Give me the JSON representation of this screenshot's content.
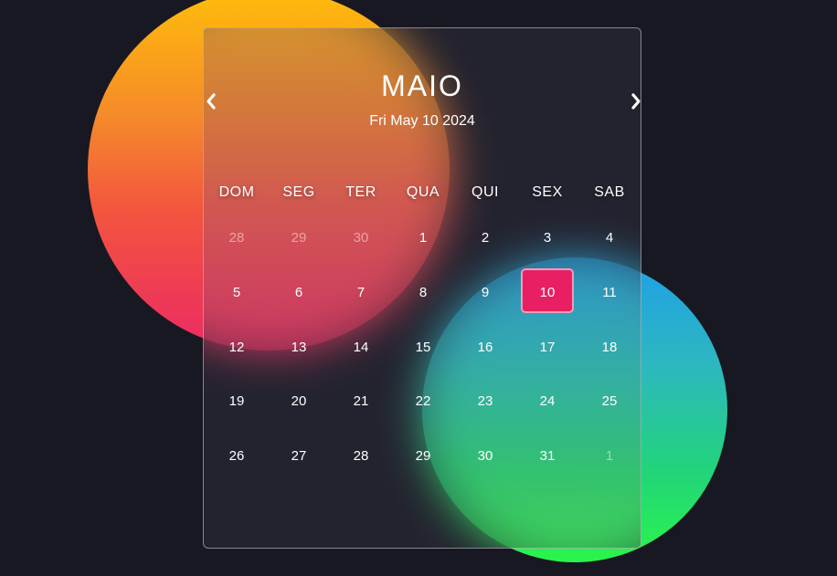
{
  "calendar": {
    "month_title": "MAIO",
    "current_date": "Fri May 10 2024",
    "prev_icon": "chevron-left-icon",
    "next_icon": "chevron-right-icon",
    "weekdays": [
      "DOM",
      "SEG",
      "TER",
      "QUA",
      "QUI",
      "SEX",
      "SAB"
    ],
    "days": [
      {
        "label": "28",
        "muted": true
      },
      {
        "label": "29",
        "muted": true
      },
      {
        "label": "30",
        "muted": true
      },
      {
        "label": "1"
      },
      {
        "label": "2"
      },
      {
        "label": "3"
      },
      {
        "label": "4"
      },
      {
        "label": "5"
      },
      {
        "label": "6"
      },
      {
        "label": "7"
      },
      {
        "label": "8"
      },
      {
        "label": "9"
      },
      {
        "label": "10",
        "selected": true
      },
      {
        "label": "11"
      },
      {
        "label": "12"
      },
      {
        "label": "13"
      },
      {
        "label": "14"
      },
      {
        "label": "15"
      },
      {
        "label": "16"
      },
      {
        "label": "17"
      },
      {
        "label": "18"
      },
      {
        "label": "19"
      },
      {
        "label": "20"
      },
      {
        "label": "21"
      },
      {
        "label": "22"
      },
      {
        "label": "23"
      },
      {
        "label": "24"
      },
      {
        "label": "25"
      },
      {
        "label": "26"
      },
      {
        "label": "27"
      },
      {
        "label": "28"
      },
      {
        "label": "29"
      },
      {
        "label": "30"
      },
      {
        "label": "31"
      },
      {
        "label": "1",
        "muted": true
      }
    ],
    "colors": {
      "background": "#181822",
      "selected_day": "#e91f63",
      "warm_blob_top": "#ffbd0a",
      "warm_blob_bottom": "#ec2a64",
      "cool_blob_top": "#1f9fe8",
      "cool_blob_bottom": "#2bf54a"
    }
  }
}
